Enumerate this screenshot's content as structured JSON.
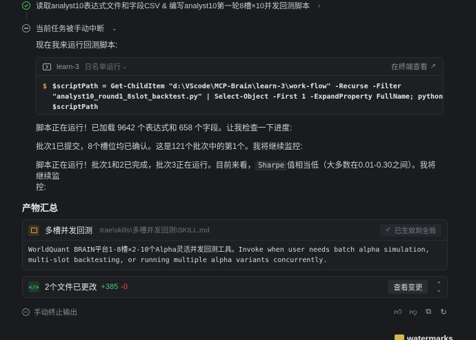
{
  "task": {
    "title": "读取analyst10表达式文件和字段CSV & 编写analyst10第一轮8槽×10并发回测脚本",
    "interrupted_label": "当前任务被手动中断"
  },
  "messages": {
    "intro": "现在我来运行回测脚本:",
    "p1": "脚本正在运行！已加载 9642 个表达式和 658 个字段。让我检查一下进度:",
    "p2": "批次1已提交，8个槽位均已确认。这是121个批次中的第1个。我将继续监控:",
    "p3_before": "脚本正在运行！批次1和2已完成，批次3正在运行。目前来看，",
    "p3_code": "Sharpe",
    "p3_after": "值相当低（大多数在0.01-0.30之间）。我将继续监",
    "p3_line2": "控:"
  },
  "terminal": {
    "name": "learn-3",
    "status": "日名单运行",
    "open_label": "在终端查看",
    "prompt": "$",
    "command_line1": "$scriptPath = Get-ChildItem \"d:\\VScode\\MCP-Brain\\learn-3\\work-flow\" -Recurse -Filter",
    "command_line2": "\"analyst10_round1_8slot_backtest.py\" | Select-Object -First 1 -ExpandProperty FullName; python",
    "command_line3": "$scriptPath"
  },
  "summary": {
    "title": "产物汇总",
    "skill": {
      "name": "多槽并发回测",
      "path": ".trae\\skills\\多槽并发回测\\SKILL.md",
      "badge": "已生效到全局",
      "desc_line1": "WorldQuant BRAIN平台1-8槽×2-10个Alpha灵活并发回测工具。Invoke when user needs batch alpha simulation,",
      "desc_line2": "multi-slot backtesting, or running multiple alpha variants concurrently."
    },
    "files": {
      "label": "2个文件已更改",
      "additions": "+385",
      "deletions": "-0",
      "view_button": "查看变更"
    }
  },
  "footer": {
    "label": "手动终止输出"
  },
  "watermark": {
    "text": "watermarks"
  },
  "colors": {
    "background": "#1a1b1f",
    "success": "#3fb950",
    "additions": "#4fc27a",
    "deletions": "#e5534b",
    "prompt": "#e0a84a"
  }
}
